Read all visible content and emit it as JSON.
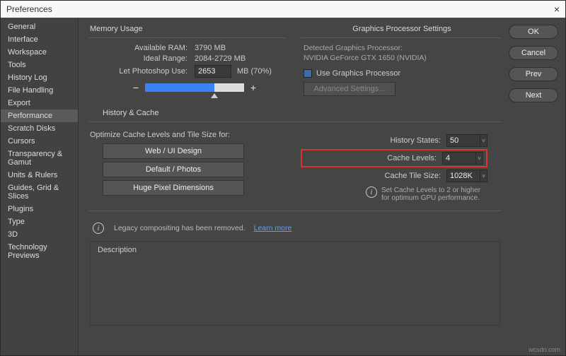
{
  "window": {
    "title": "Preferences",
    "close": "×"
  },
  "sidebar": {
    "items": [
      "General",
      "Interface",
      "Workspace",
      "Tools",
      "History Log",
      "File Handling",
      "Export",
      "Performance",
      "Scratch Disks",
      "Cursors",
      "Transparency & Gamut",
      "Units & Rulers",
      "Guides, Grid & Slices",
      "Plugins",
      "Type",
      "3D",
      "Technology Previews"
    ],
    "selected_index": 7
  },
  "buttons": {
    "ok": "OK",
    "cancel": "Cancel",
    "prev": "Prev",
    "next": "Next"
  },
  "memory": {
    "title": "Memory Usage",
    "available_label": "Available RAM:",
    "available_value": "3790 MB",
    "ideal_label": "Ideal Range:",
    "ideal_value": "2084-2729 MB",
    "use_label": "Let Photoshop Use:",
    "use_value": "2653",
    "use_suffix": "MB (70%)",
    "minus": "−",
    "plus": "+"
  },
  "graphics": {
    "title": "Graphics Processor Settings",
    "detected_label": "Detected Graphics Processor:",
    "detected_value": "NVIDIA GeForce GTX 1650 (NVIDIA)",
    "checkbox_label": "Use Graphics Processor",
    "advanced": "Advanced Settings..."
  },
  "history": {
    "title": "History & Cache",
    "optimize_label": "Optimize Cache Levels and Tile Size for:",
    "web_btn": "Web / UI Design",
    "default_btn": "Default / Photos",
    "huge_btn": "Huge Pixel Dimensions",
    "states_label": "History States:",
    "states_value": "50",
    "levels_label": "Cache Levels:",
    "levels_value": "4",
    "tile_label": "Cache Tile Size:",
    "tile_value": "1028K",
    "info": "Set Cache Levels to 2 or higher for optimum GPU performance."
  },
  "legacy": {
    "text": "Legacy compositing has been removed.",
    "link": "Learn more"
  },
  "description": {
    "title": "Description"
  },
  "watermark": "wcsdn.com"
}
